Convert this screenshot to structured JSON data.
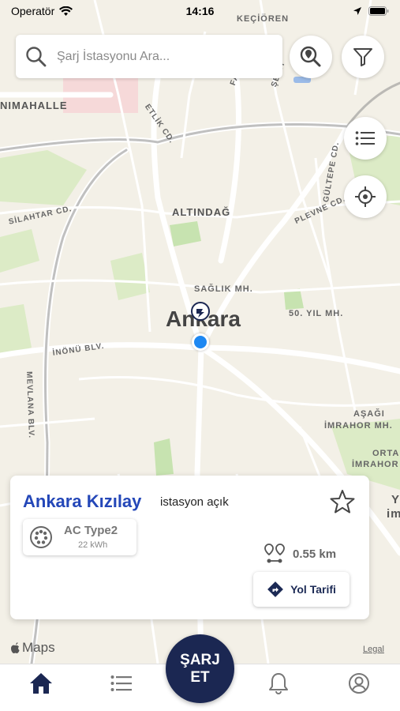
{
  "status_bar": {
    "carrier": "Operatör",
    "time": "14:16"
  },
  "search": {
    "placeholder": "Şarj İstasyonu Ara..."
  },
  "map": {
    "labels": {
      "kecioren": "KEÇİÖREN",
      "nimahalle": "NIMAHALLE",
      "etlik": "ETLİK CD.",
      "fatih": "FATİH",
      "sehit": "ŞEHİT",
      "silahtar": "SİLAHTAR CD.",
      "altindag": "ALTINDAĞ",
      "gultepe": "GÜLTEPE CD.",
      "plevne": "PLEVNE CD.",
      "saglik": "SAĞLIK MH.",
      "ankara": "Ankara",
      "elli_yil": "50. YIL MH.",
      "inonu": "İNÖNÜ BLV.",
      "mevlana": "MEVLANA BLV.",
      "asagi": "AŞAĞI",
      "imrahor_mh": "İMRAHOR MH.",
      "orta": "ORTA",
      "imrahor": "İMRAHOR",
      "edge_y": "Y",
      "edge_im": "im"
    }
  },
  "station_card": {
    "name": "Ankara Kızılay",
    "status": "istasyon açık",
    "connector_type": "AC Type2",
    "connector_power": "22 kWh",
    "distance": "0.55 km",
    "route_label": "Yol Tarifi"
  },
  "attribution": {
    "maps": "Maps",
    "legal": "Legal"
  },
  "charge_button": {
    "line1": "ŞARJ",
    "line2": "ET"
  },
  "colors": {
    "brand_navy": "#1b2752",
    "title_blue": "#2447b8",
    "user_dot": "#1e88f2"
  }
}
